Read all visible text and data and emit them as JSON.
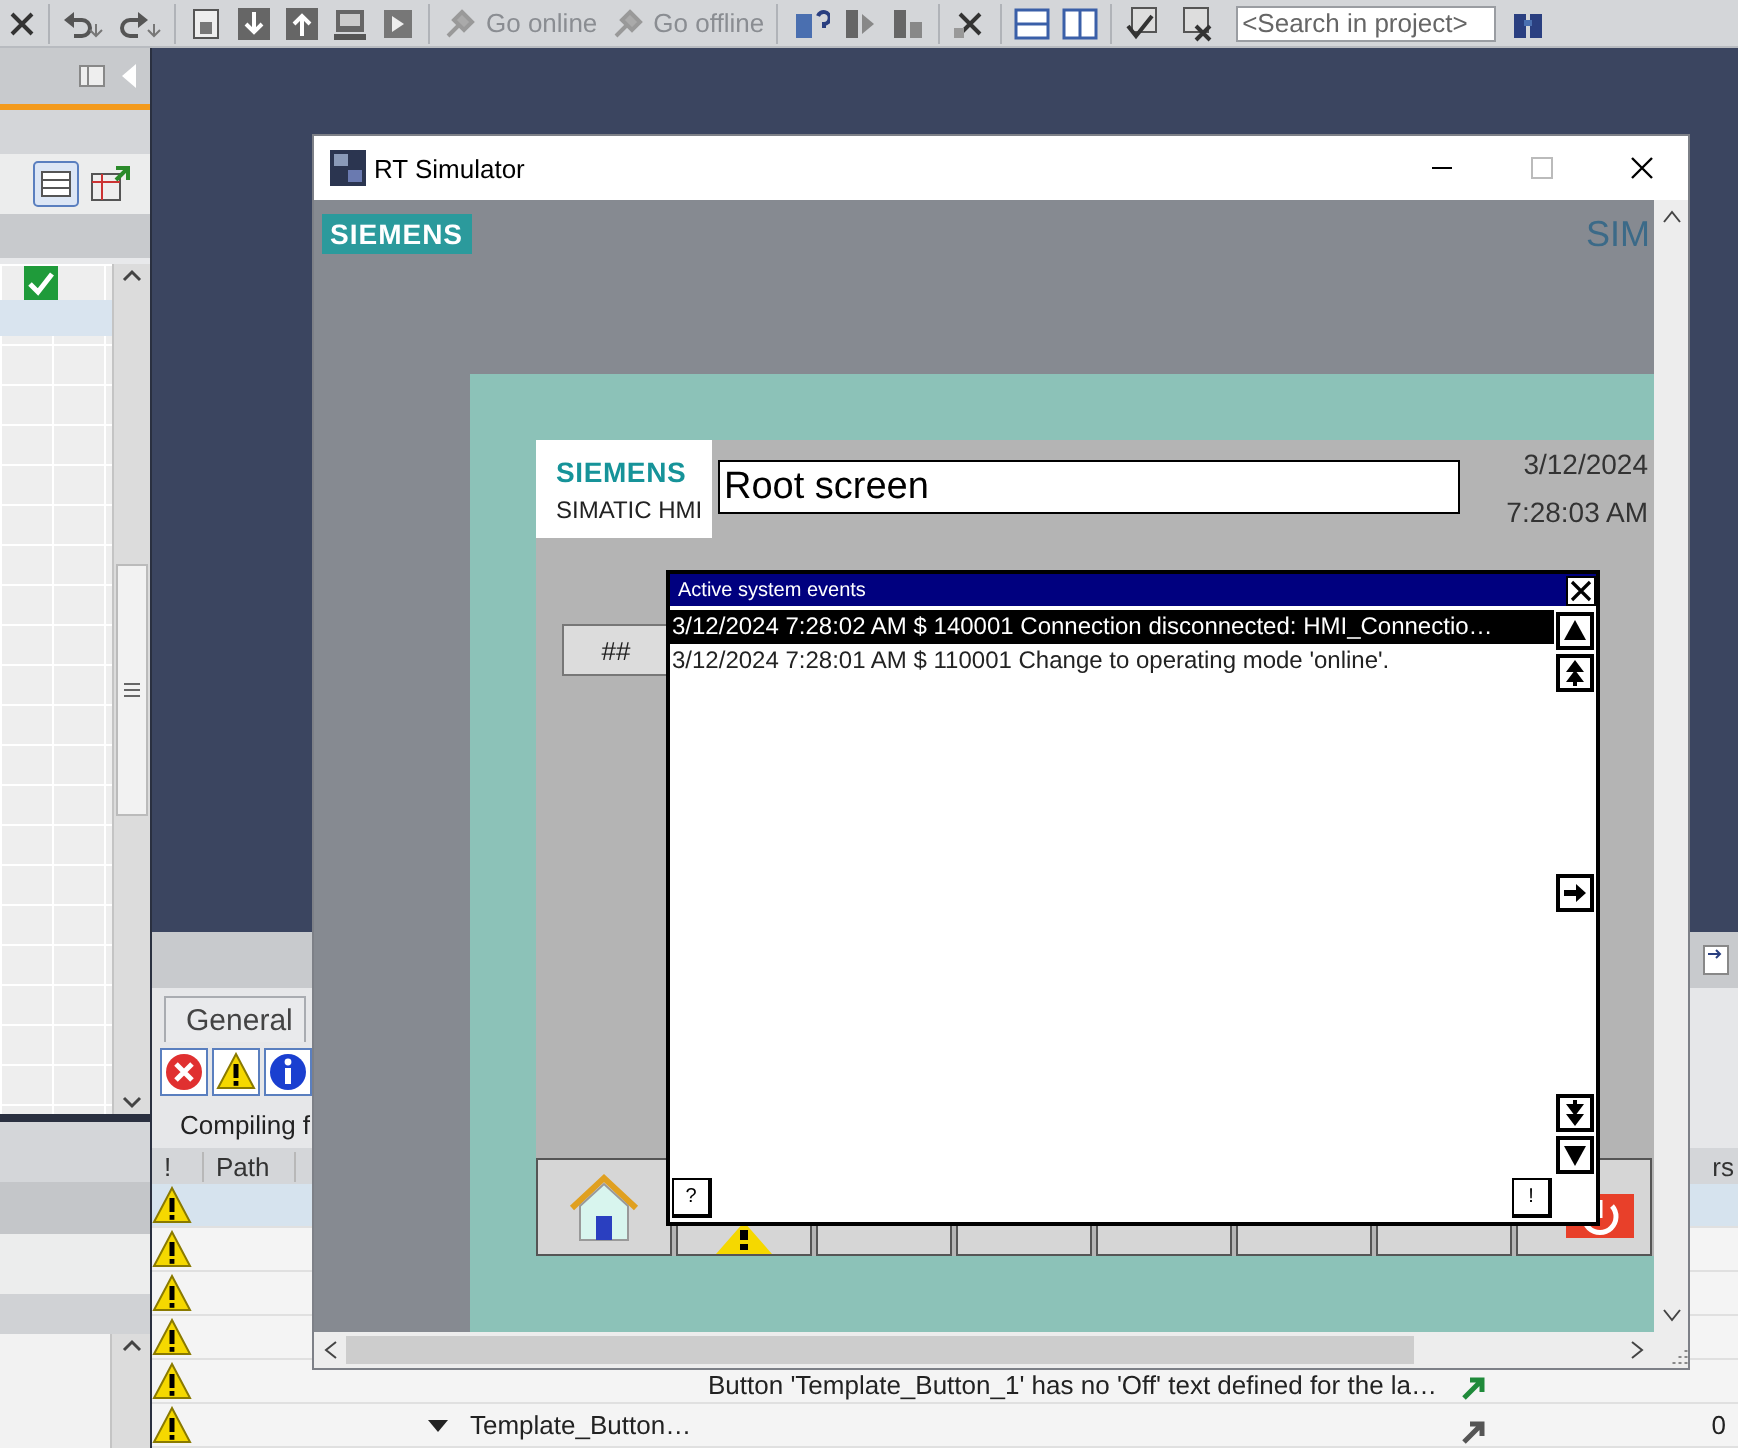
{
  "toolbar": {
    "go_online": {
      "label": "Go online",
      "disabled": true
    },
    "go_offline": {
      "label": "Go offline",
      "disabled": true
    },
    "search": {
      "placeholder": "<Search in project>"
    }
  },
  "project_tree": {
    "rows": [
      {
        "ok": true,
        "selected": false
      },
      {
        "ok": false,
        "selected": true
      }
    ]
  },
  "inspector": {
    "tabs": [
      {
        "label": "General",
        "selected": true
      }
    ],
    "filters": [
      {
        "kind": "error",
        "on": true
      },
      {
        "kind": "warning",
        "on": true
      },
      {
        "kind": "info",
        "on": true
      }
    ],
    "message": "Compiling f",
    "columns": [
      "!",
      "Path"
    ],
    "column_3": "rs",
    "rows": [
      {
        "kind": "warning",
        "selected": true
      },
      {
        "kind": "warning",
        "selected": false
      },
      {
        "kind": "warning",
        "selected": false
      },
      {
        "kind": "warning",
        "selected": false
      },
      {
        "kind": "warning",
        "selected": false,
        "description": "Button 'Template_Button_1' has no 'Off' text defined for the la…"
      },
      {
        "kind": "warning",
        "selected": false,
        "path": "Template_Button…",
        "expanded": true,
        "count": "0"
      }
    ]
  },
  "simulator": {
    "title": "RT Simulator",
    "logo": "SIEMENS",
    "brand": "SIM",
    "hmi": {
      "logo": "SIEMENS",
      "product": "SIMATIC HMI",
      "screen_title": "Root screen",
      "date": "3/12/2024",
      "time": "7:28:03 AM",
      "button": "##",
      "function_keys": [
        {
          "kind": "home"
        },
        {
          "kind": "alarms"
        },
        {
          "kind": "blank"
        },
        {
          "kind": "blank"
        },
        {
          "kind": "blank"
        },
        {
          "kind": "blank"
        },
        {
          "kind": "blank"
        },
        {
          "kind": "exit"
        }
      ],
      "events": {
        "title": "Active system events",
        "rows": [
          {
            "text": "3/12/2024 7:28:02 AM $ 140001 Connection disconnected: HMI_Connectio…",
            "selected": true
          },
          {
            "text": "3/12/2024 7:28:01 AM $ 110001 Change to operating mode 'online'.",
            "selected": false
          }
        ],
        "help": "?",
        "acknowledge": "!"
      }
    }
  }
}
